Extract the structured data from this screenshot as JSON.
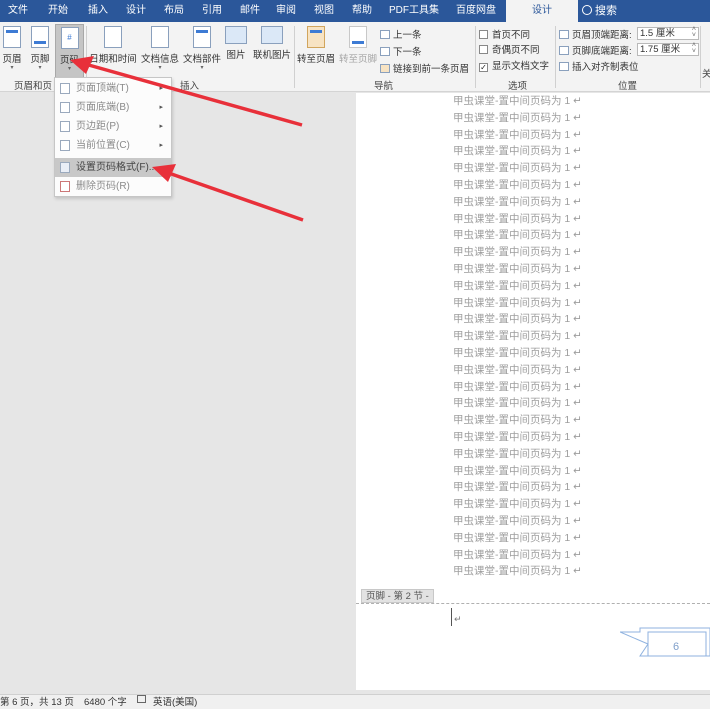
{
  "tabs": [
    {
      "label": "文件"
    },
    {
      "label": "开始"
    },
    {
      "label": "插入"
    },
    {
      "label": "设计"
    },
    {
      "label": "布局"
    },
    {
      "label": "引用"
    },
    {
      "label": "邮件"
    },
    {
      "label": "审阅"
    },
    {
      "label": "视图"
    },
    {
      "label": "帮助"
    },
    {
      "label": "PDF工具集"
    },
    {
      "label": "百度网盘"
    },
    {
      "label": "设计"
    }
  ],
  "active_tab": "设计",
  "search": {
    "label": "搜索"
  },
  "ribbon": {
    "buttons": {
      "header": "页眉",
      "footer": "页脚",
      "page_number": "页码",
      "date_time": "日期和时间",
      "doc_info": "文档信息",
      "doc_parts": "文档部件",
      "picture": "图片",
      "online_picture": "联机图片",
      "goto_header": "转至页眉",
      "goto_footer": "转至页脚"
    },
    "nav": {
      "previous": "上一条",
      "next": "下一条",
      "link_previous": "链接到前一条页眉"
    },
    "options": {
      "diff_first": "首页不同",
      "diff_odd_even": "奇偶页不同",
      "show_doc_text": "显示文档文字",
      "show_doc_text_checked": true
    },
    "position": {
      "header_top_label": "页眉顶端距离:",
      "header_top_value": "1.5 厘米",
      "footer_bottom_label": "页脚底端距离:",
      "footer_bottom_value": "1.75 厘米",
      "insert_align_tab": "插入对齐制表位"
    },
    "groups": {
      "header_footer": "页眉和页",
      "insert": "插入",
      "navigation": "导航",
      "options": "选项",
      "position": "位置",
      "close": "关"
    }
  },
  "menu": {
    "items": [
      {
        "label": "页面顶端(T)",
        "submenu": "▸"
      },
      {
        "label": "页面底端(B)",
        "submenu": "▸"
      },
      {
        "label": "页边距(P)",
        "submenu": "▸"
      },
      {
        "label": "当前位置(C)",
        "submenu": "▸"
      },
      {
        "label": "设置页码格式(F)...",
        "submenu": ""
      },
      {
        "label": "删除页码(R)",
        "submenu": ""
      }
    ],
    "highlighted": "设置页码格式(F)..."
  },
  "document": {
    "line_text": "甲虫课堂-置中间页码为 1",
    "line_count": 29,
    "footer_label": "页脚 - 第 2 节 -",
    "page_number_shown": "6"
  },
  "status": {
    "page": "第 6 页，共 13 页",
    "words": "6480 个字",
    "language": "英语(美国)"
  },
  "colors": {
    "tab_bar": "#2b579a",
    "ribbon": "#f3f3f3",
    "arrow": "#e8303a",
    "body_text": "#9e9e9e"
  }
}
